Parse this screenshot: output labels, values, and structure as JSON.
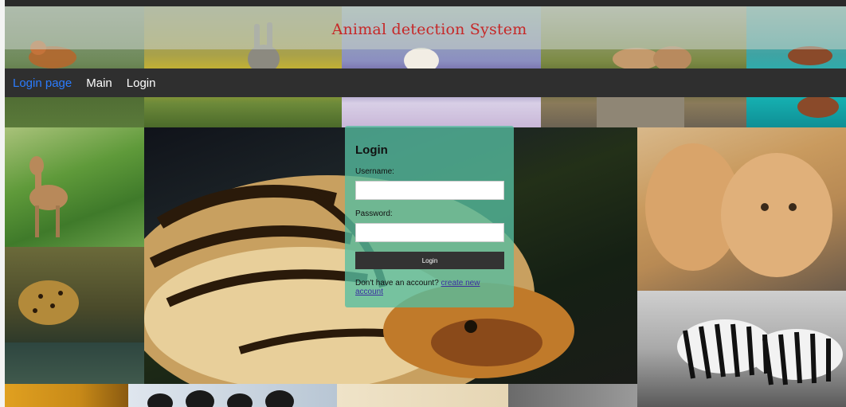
{
  "banner": {
    "title": "Animal detection System"
  },
  "nav": {
    "items": [
      {
        "label": "Login page",
        "active": true
      },
      {
        "label": "Main",
        "active": false
      },
      {
        "label": "Login",
        "active": false
      }
    ]
  },
  "login": {
    "title": "Login",
    "username_label": "Username:",
    "username_value": "",
    "password_label": "Password:",
    "password_value": "",
    "button_label": "Login",
    "signup_prompt": "Don't have an account?",
    "signup_link": "create new account"
  },
  "colors": {
    "nav_bg": "#2f2f2f",
    "nav_active": "#2b7cff",
    "title_red": "#c62828",
    "card_bg": "#56bea0",
    "button_bg": "#333333",
    "link": "#3b2fa0"
  }
}
